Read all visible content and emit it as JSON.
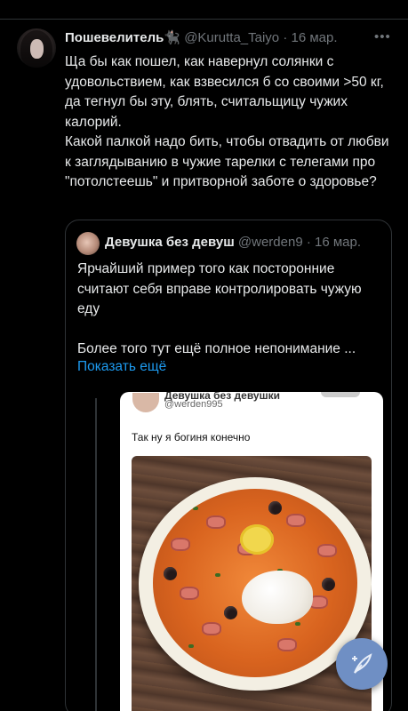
{
  "tweet": {
    "author_name": "Пошевелитель🐈‍⬛",
    "author_handle": "@Kurutta_Taiyo",
    "separator": "·",
    "date": "16 мар.",
    "more_icon": "more-dots-icon",
    "text_line1": "Ща бы как пошел, как навернул солянки с удовольствием, как взвесился б со своими >50 кг, да тегнул бы эту, блять, считальщицу чужих калорий.",
    "text_line2": "Какой палкой надо бить, чтобы отвадить от любви к заглядыванию в чужие тарелки с телегами про \"потолстеешь\" и притворной заботе о здоровье?"
  },
  "quote": {
    "author_name": "Девушка без девуш",
    "author_handle": "@werden9",
    "separator": "·",
    "date": "16 мар.",
    "text_line1": "Ярчайший пример того как посторонние считают себя вправе контролировать чужую еду",
    "text_line2": "Более того тут ещё полное непонимание ...",
    "show_more": "Показать ещё",
    "embedded": {
      "author_name": "Девушка без девушки",
      "author_handle": "@werden995",
      "text": "Так ну я богиня конечно",
      "image": "soup-photo"
    }
  },
  "fab": {
    "icon": "compose-feather-icon",
    "color": "#6f8fc4"
  },
  "colors": {
    "background": "#000000",
    "text": "#e7e9ea",
    "secondary": "#71767b",
    "link": "#1d9bf0",
    "border": "#2f3336"
  }
}
